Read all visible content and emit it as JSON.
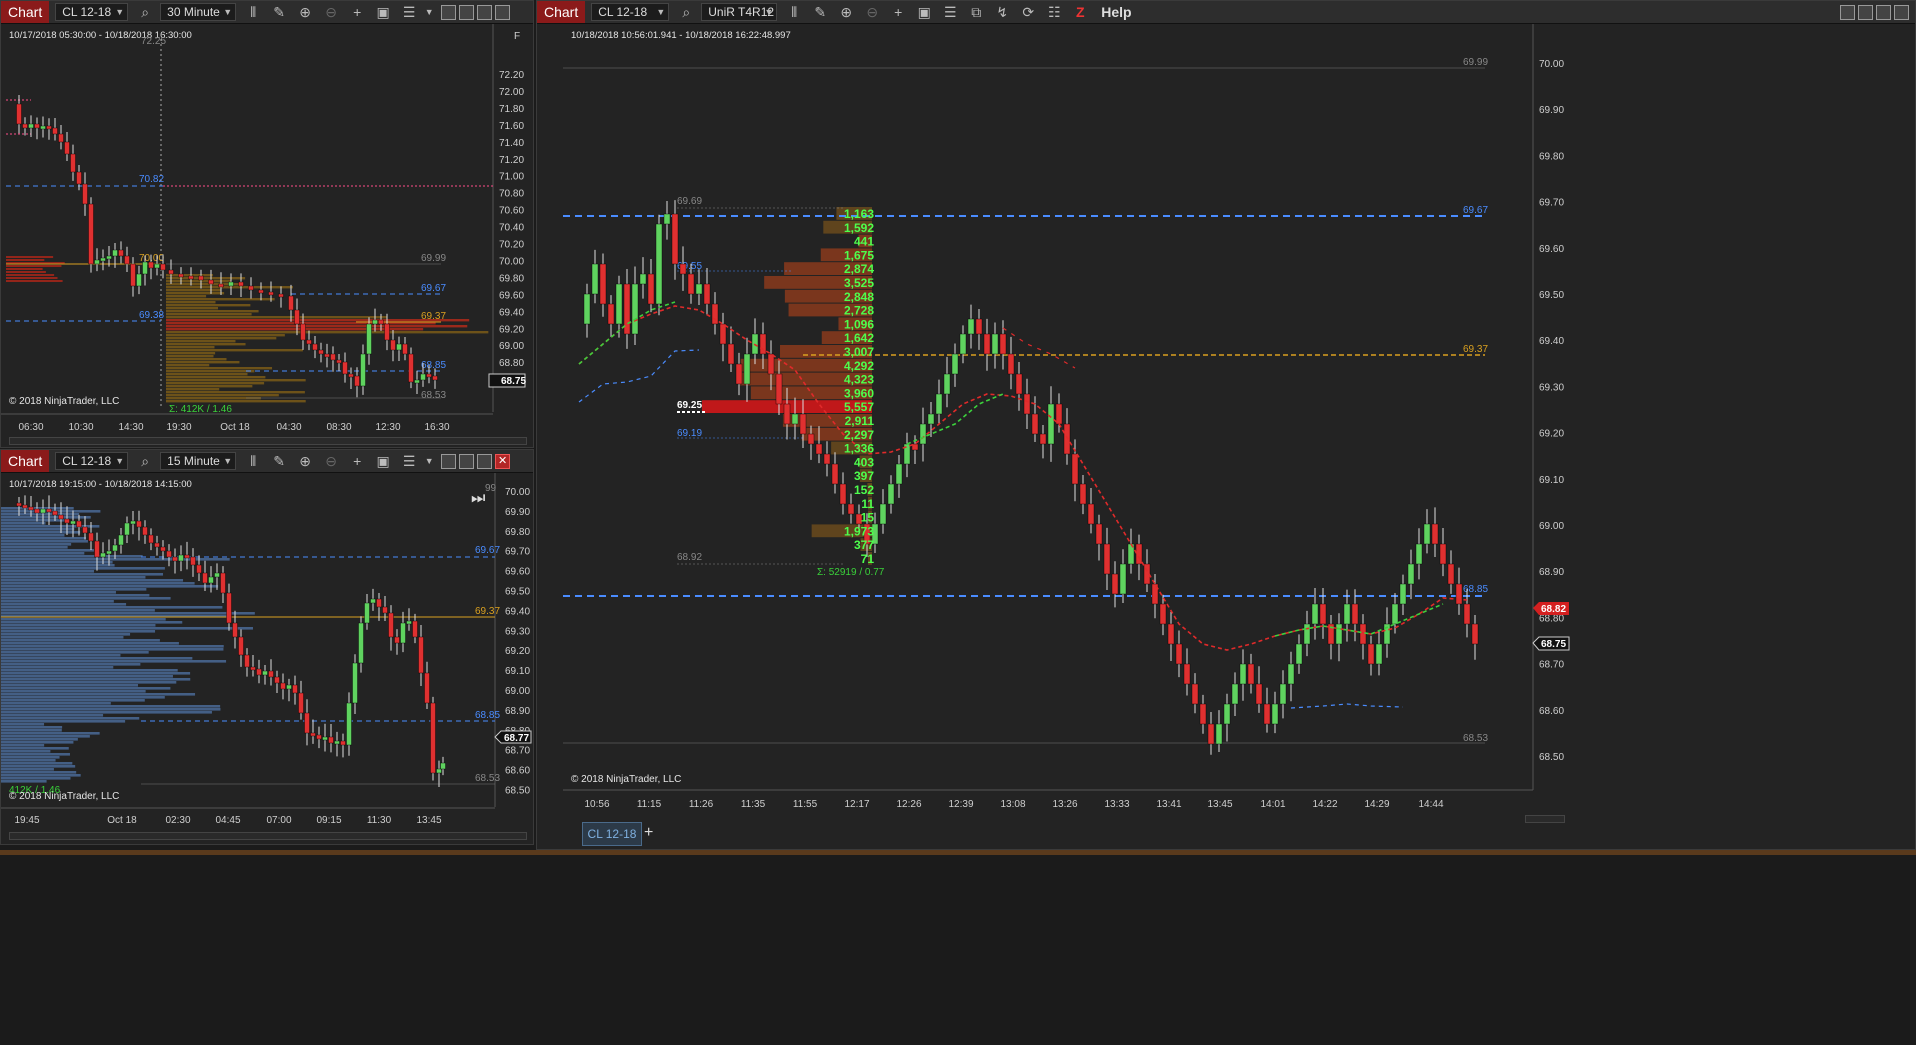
{
  "chart1": {
    "tag": "Chart",
    "instrument": "CL 12-18",
    "interval": "30 Minute",
    "range": "10/17/2018 05:30:00 - 10/18/2018 16:30:00",
    "copyright": "© 2018 NinjaTrader, LLC",
    "f_button": "F",
    "y_ticks": [
      "72.20",
      "72.00",
      "71.80",
      "71.60",
      "71.40",
      "71.20",
      "71.00",
      "70.80",
      "70.60",
      "70.40",
      "70.20",
      "70.00",
      "69.80",
      "69.60",
      "69.40",
      "69.20",
      "69.00",
      "68.80",
      "68.60"
    ],
    "top_tick": "72.25",
    "x_ticks": [
      "06:30",
      "10:30",
      "14:30",
      "19:30",
      "Oct 18",
      "04:30",
      "08:30",
      "12:30",
      "16:30"
    ],
    "levels": {
      "l7082": "70.82",
      "l7000": "70.00",
      "l6999": "69.99",
      "l6967": "69.67",
      "l6938": "69.38",
      "l6937": "69.37",
      "l6885": "68.85",
      "l6853": "68.53"
    },
    "last_price": "68.75",
    "sigma": "Σ: 412K / 1.46"
  },
  "chart2": {
    "tag": "Chart",
    "instrument": "CL 12-18",
    "interval": "15 Minute",
    "range": "10/17/2018 19:15:00 - 10/18/2018 14:15:00",
    "copyright": "© 2018 NinjaTrader, LLC",
    "y_ticks": [
      "70.00",
      "69.90",
      "69.80",
      "69.70",
      "69.60",
      "69.50",
      "69.40",
      "69.30",
      "69.20",
      "69.10",
      "69.00",
      "68.90",
      "68.80",
      "68.70",
      "68.60",
      "68.50"
    ],
    "top_tick": "99",
    "x_ticks": [
      "19:45",
      "Oct 18",
      "02:30",
      "04:45",
      "07:00",
      "09:15",
      "11:30",
      "13:45"
    ],
    "levels": {
      "l6967": "69.67",
      "l6937": "69.37",
      "l6885": "68.85",
      "l6853": "68.53"
    },
    "last_price": "68.77",
    "sigma": "412K / 1.46"
  },
  "chart3": {
    "tag": "Chart",
    "instrument": "CL 12-18",
    "interval": "UniR T4R12",
    "help": "Help",
    "range": "10/18/2018 10:56:01.941 - 10/18/2018 16:22:48.997",
    "copyright": "© 2018 NinjaTrader, LLC",
    "y_ticks": [
      "70.00",
      "69.90",
      "69.80",
      "69.70",
      "69.60",
      "69.50",
      "69.40",
      "69.30",
      "69.20",
      "69.10",
      "69.00",
      "68.90",
      "68.80",
      "68.70",
      "68.60",
      "68.50"
    ],
    "x_ticks": [
      "10:56",
      "11:15",
      "11:26",
      "11:35",
      "11:55",
      "12:17",
      "12:26",
      "12:39",
      "13:08",
      "13:26",
      "13:33",
      "13:41",
      "13:45",
      "14:01",
      "14:22",
      "14:29",
      "14:44"
    ],
    "levels": {
      "l6999": "69.99",
      "l6967": "69.67",
      "l6937": "69.37",
      "l6885": "68.85",
      "l6853": "68.53",
      "l6969": "69.69",
      "l6955": "69.55",
      "l6925": "69.25",
      "l6919": "69.19",
      "l6892": "68.92"
    },
    "profile_values": [
      "1,163",
      "1,592",
      "441",
      "1,675",
      "2,874",
      "3,525",
      "2,848",
      "2,728",
      "1,096",
      "1,642",
      "3,007",
      "4,292",
      "4,323",
      "3,960",
      "5,557",
      "2,911",
      "2,297",
      "1,336",
      "403",
      "397",
      "152",
      "11",
      "15",
      "1,973",
      "377",
      "71"
    ],
    "sigma": "Σ: 52919 / 0.77",
    "price_red": "68.82",
    "price_white": "68.75",
    "tab": "CL 12-18",
    "tab_plus": "+"
  },
  "colors": {
    "up": "#5fd35f",
    "down": "#e03030",
    "blue_level": "#4a8cff",
    "orange_level": "#d9a020",
    "bg": "#232323"
  }
}
